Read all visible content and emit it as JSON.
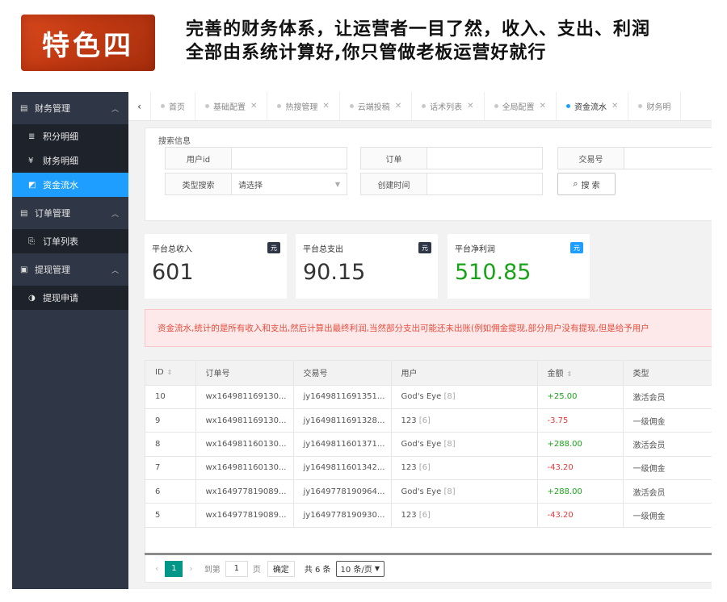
{
  "banner": {
    "badge": "特色四",
    "headline_line1": "完善的财务体系，让运营者一目了然，收入、支出、利润",
    "headline_line2": "全部由系统计算好,你只管做老板运营好就行"
  },
  "sidebar": {
    "groups": [
      {
        "icon": "▤",
        "label": "财务管理",
        "items": [
          {
            "icon": "≣",
            "label": "积分明细",
            "active": false
          },
          {
            "icon": "¥",
            "label": "财务明细",
            "active": false
          },
          {
            "icon": "◩",
            "label": "资金流水",
            "active": true
          }
        ]
      },
      {
        "icon": "▤",
        "label": "订单管理",
        "items": [
          {
            "icon": "⎘",
            "label": "订单列表",
            "active": false
          }
        ]
      },
      {
        "icon": "▣",
        "label": "提现管理",
        "items": [
          {
            "icon": "◑",
            "label": "提现申请",
            "active": false
          }
        ]
      }
    ]
  },
  "tabs": [
    {
      "label": "首页",
      "closable": false,
      "active": false
    },
    {
      "label": "基础配置",
      "closable": true,
      "active": false
    },
    {
      "label": "热搜管理",
      "closable": true,
      "active": false
    },
    {
      "label": "云端投稿",
      "closable": true,
      "active": false
    },
    {
      "label": "话术列表",
      "closable": true,
      "active": false
    },
    {
      "label": "全局配置",
      "closable": true,
      "active": false
    },
    {
      "label": "资金流水",
      "closable": true,
      "active": true
    },
    {
      "label": "财务明",
      "closable": false,
      "active": false
    }
  ],
  "search": {
    "title": "搜索信息",
    "user_id_label": "用户id",
    "user_id_value": "",
    "order_label": "订单",
    "order_value": "",
    "trade_no_label": "交易号",
    "trade_no_value": "",
    "type_label": "类型搜索",
    "type_value": "请选择",
    "created_label": "创建时间",
    "created_value": "",
    "button_label": "搜 索"
  },
  "stats": [
    {
      "label": "平台总收入",
      "badge": "元",
      "badge_color": "#2f3645",
      "value": "601",
      "value_color": "#333333"
    },
    {
      "label": "平台总支出",
      "badge": "元",
      "badge_color": "#2f3645",
      "value": "90.15",
      "value_color": "#333333"
    },
    {
      "label": "平台净利润",
      "badge": "元",
      "badge_color": "#1e9fff",
      "value": "510.85",
      "value_color": "#1aa31a"
    }
  ],
  "notice": "资金流水,统计的是所有收入和支出,然后计算出最终利润,当然部分支出可能还未出账(例如佣金提现,部分用户没有提现,但是给予用户",
  "table": {
    "columns": [
      "ID",
      "订单号",
      "交易号",
      "用户",
      "金额",
      "类型"
    ],
    "rows": [
      {
        "id": "10",
        "order": "wx164981169130...",
        "trade": "jy1649811691351...",
        "user": "God's Eye",
        "uid": "[8]",
        "amount": "+25.00",
        "sign": "pos",
        "type": "激活会员"
      },
      {
        "id": "9",
        "order": "wx164981169130...",
        "trade": "jy1649811691328...",
        "user": "123",
        "uid": "[6]",
        "amount": "-3.75",
        "sign": "neg",
        "type": "一级佣金"
      },
      {
        "id": "8",
        "order": "wx164981160130...",
        "trade": "jy1649811601371...",
        "user": "God's Eye",
        "uid": "[8]",
        "amount": "+288.00",
        "sign": "pos",
        "type": "激活会员"
      },
      {
        "id": "7",
        "order": "wx164981160130...",
        "trade": "jy1649811601342...",
        "user": "123",
        "uid": "[6]",
        "amount": "-43.20",
        "sign": "neg",
        "type": "一级佣金"
      },
      {
        "id": "6",
        "order": "wx164977819089...",
        "trade": "jy1649778190964...",
        "user": "God's Eye",
        "uid": "[8]",
        "amount": "+288.00",
        "sign": "pos",
        "type": "激活会员"
      },
      {
        "id": "5",
        "order": "wx164977819089...",
        "trade": "jy1649778190930...",
        "user": "123",
        "uid": "[6]",
        "amount": "-43.20",
        "sign": "neg",
        "type": "一级佣金"
      }
    ]
  },
  "pager": {
    "current": "1",
    "goto_label": "到第",
    "goto_value": "1",
    "page_unit": "页",
    "confirm": "确定",
    "total": "共 6 条",
    "page_size": "10 条/页"
  }
}
